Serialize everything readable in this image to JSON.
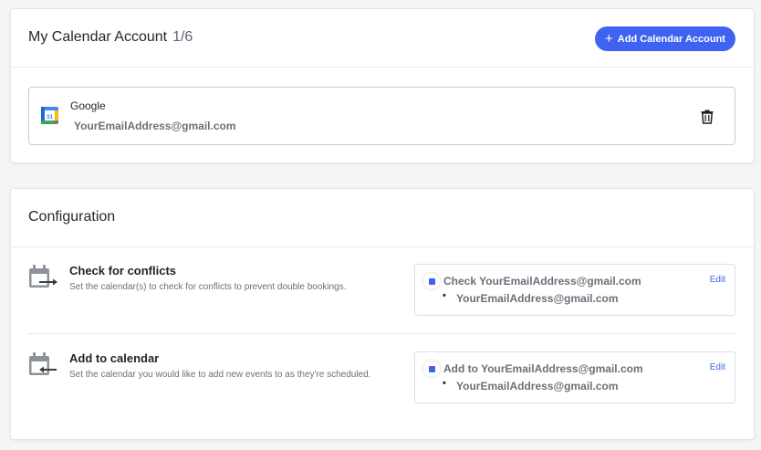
{
  "accounts_card": {
    "title": "My Calendar Account",
    "count": "1/6",
    "add_button_label": "Add Calendar Account",
    "accounts": [
      {
        "provider": "Google",
        "email": "YourEmailAddress@gmail.com",
        "icon": "google-calendar-icon"
      }
    ]
  },
  "config_card": {
    "title": "Configuration",
    "sections": [
      {
        "title": "Check for conflicts",
        "description": "Set the calendar(s) to check for conflicts to prevent double bookings.",
        "box_main": "Check YourEmailAddress@gmail.com",
        "box_sub": "YourEmailAddress@gmail.com",
        "edit_label": "Edit",
        "icon": "calendar-arrow-out-icon"
      },
      {
        "title": "Add to calendar",
        "description": "Set the calendar you would like to add new events to as they're scheduled.",
        "box_main": "Add to YourEmailAddress@gmail.com",
        "box_sub": "YourEmailAddress@gmail.com",
        "edit_label": "Edit",
        "icon": "calendar-arrow-in-icon"
      }
    ]
  },
  "colors": {
    "accent": "#3f63f0",
    "muted_text": "#6b7079",
    "border": "#c9ccd1"
  }
}
